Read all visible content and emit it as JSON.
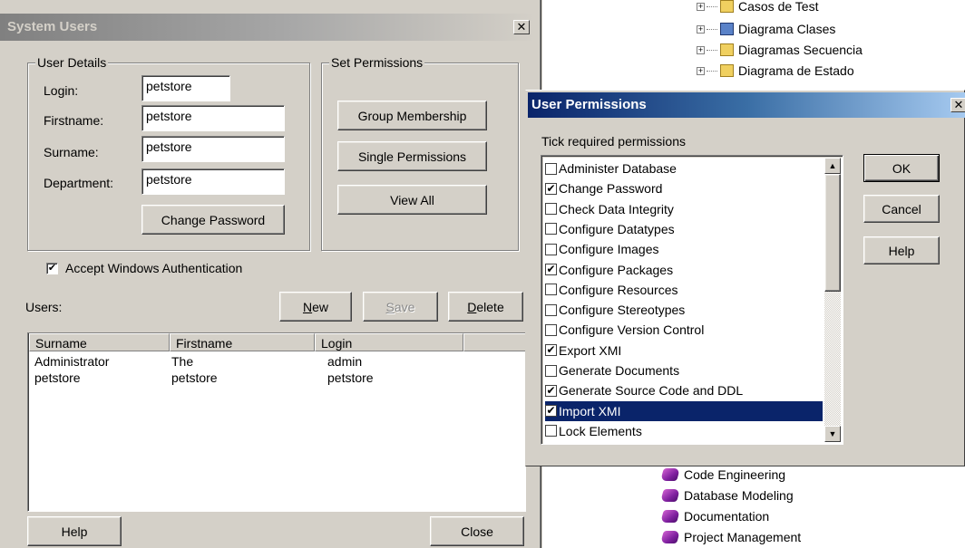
{
  "system_users": {
    "title": "System Users",
    "close_glyph": "✕",
    "user_details": {
      "legend": "User Details",
      "login_label": "Login:",
      "login_value": "petstore",
      "firstname_label": "Firstname:",
      "firstname_value": "petstore",
      "surname_label": "Surname:",
      "surname_value": "petstore",
      "department_label": "Department:",
      "department_value": "petstore",
      "change_password": "Change Password"
    },
    "set_permissions": {
      "legend": "Set Permissions",
      "group_membership": "Group Membership",
      "single_permissions": "Single Permissions",
      "view_all": "View All"
    },
    "accept_windows_auth": "Accept Windows Authentication",
    "accept_windows_auth_checked": true,
    "users_label": "Users:",
    "new_label_u": "N",
    "new_label_rest": "ew",
    "save_label_u": "S",
    "save_label_rest": "ave",
    "delete_label_u": "D",
    "delete_label_rest": "elete",
    "columns": [
      "Surname",
      "Firstname",
      "Login"
    ],
    "rows": [
      {
        "surname": "Administrator",
        "firstname": "The",
        "login": "admin"
      },
      {
        "surname": "petstore",
        "firstname": "petstore",
        "login": "petstore"
      }
    ],
    "help": "Help",
    "close": "Close"
  },
  "tree": {
    "items_top": [
      {
        "label": "Casos de Test",
        "icon": "folder-icon"
      },
      {
        "label": "Diagrama Clases",
        "icon": "class-icon"
      },
      {
        "label": "Diagramas Secuencia",
        "icon": "folder-icon"
      },
      {
        "label": "Diagrama de Estado",
        "icon": "folder-icon"
      }
    ],
    "items_bottom": [
      {
        "label": "Code Engineering",
        "icon": "book-icon"
      },
      {
        "label": "Database Modeling",
        "icon": "book-icon"
      },
      {
        "label": "Documentation",
        "icon": "book-icon"
      },
      {
        "label": "Project Management",
        "icon": "book-icon"
      }
    ]
  },
  "user_permissions": {
    "title": "User Permissions",
    "close_glyph": "✕",
    "prompt": "Tick required permissions",
    "ok": "OK",
    "cancel": "Cancel",
    "help": "Help",
    "permissions": [
      {
        "label": "Administer Database",
        "checked": false
      },
      {
        "label": "Change Password",
        "checked": true
      },
      {
        "label": "Check Data Integrity",
        "checked": false
      },
      {
        "label": "Configure Datatypes",
        "checked": false
      },
      {
        "label": "Configure Images",
        "checked": false
      },
      {
        "label": "Configure Packages",
        "checked": true
      },
      {
        "label": "Configure Resources",
        "checked": false
      },
      {
        "label": "Configure Stereotypes",
        "checked": false
      },
      {
        "label": "Configure Version Control",
        "checked": false
      },
      {
        "label": "Export XMI",
        "checked": true
      },
      {
        "label": "Generate Documents",
        "checked": false
      },
      {
        "label": "Generate Source Code and DDL",
        "checked": true
      },
      {
        "label": "Import XMI",
        "checked": true,
        "selected": true
      },
      {
        "label": "Lock Elements",
        "checked": false
      }
    ]
  },
  "colors": {
    "face": "#d4d0c8",
    "selection": "#0a246a",
    "titlebar_start": "#0a246a",
    "titlebar_end": "#a6caf0"
  }
}
